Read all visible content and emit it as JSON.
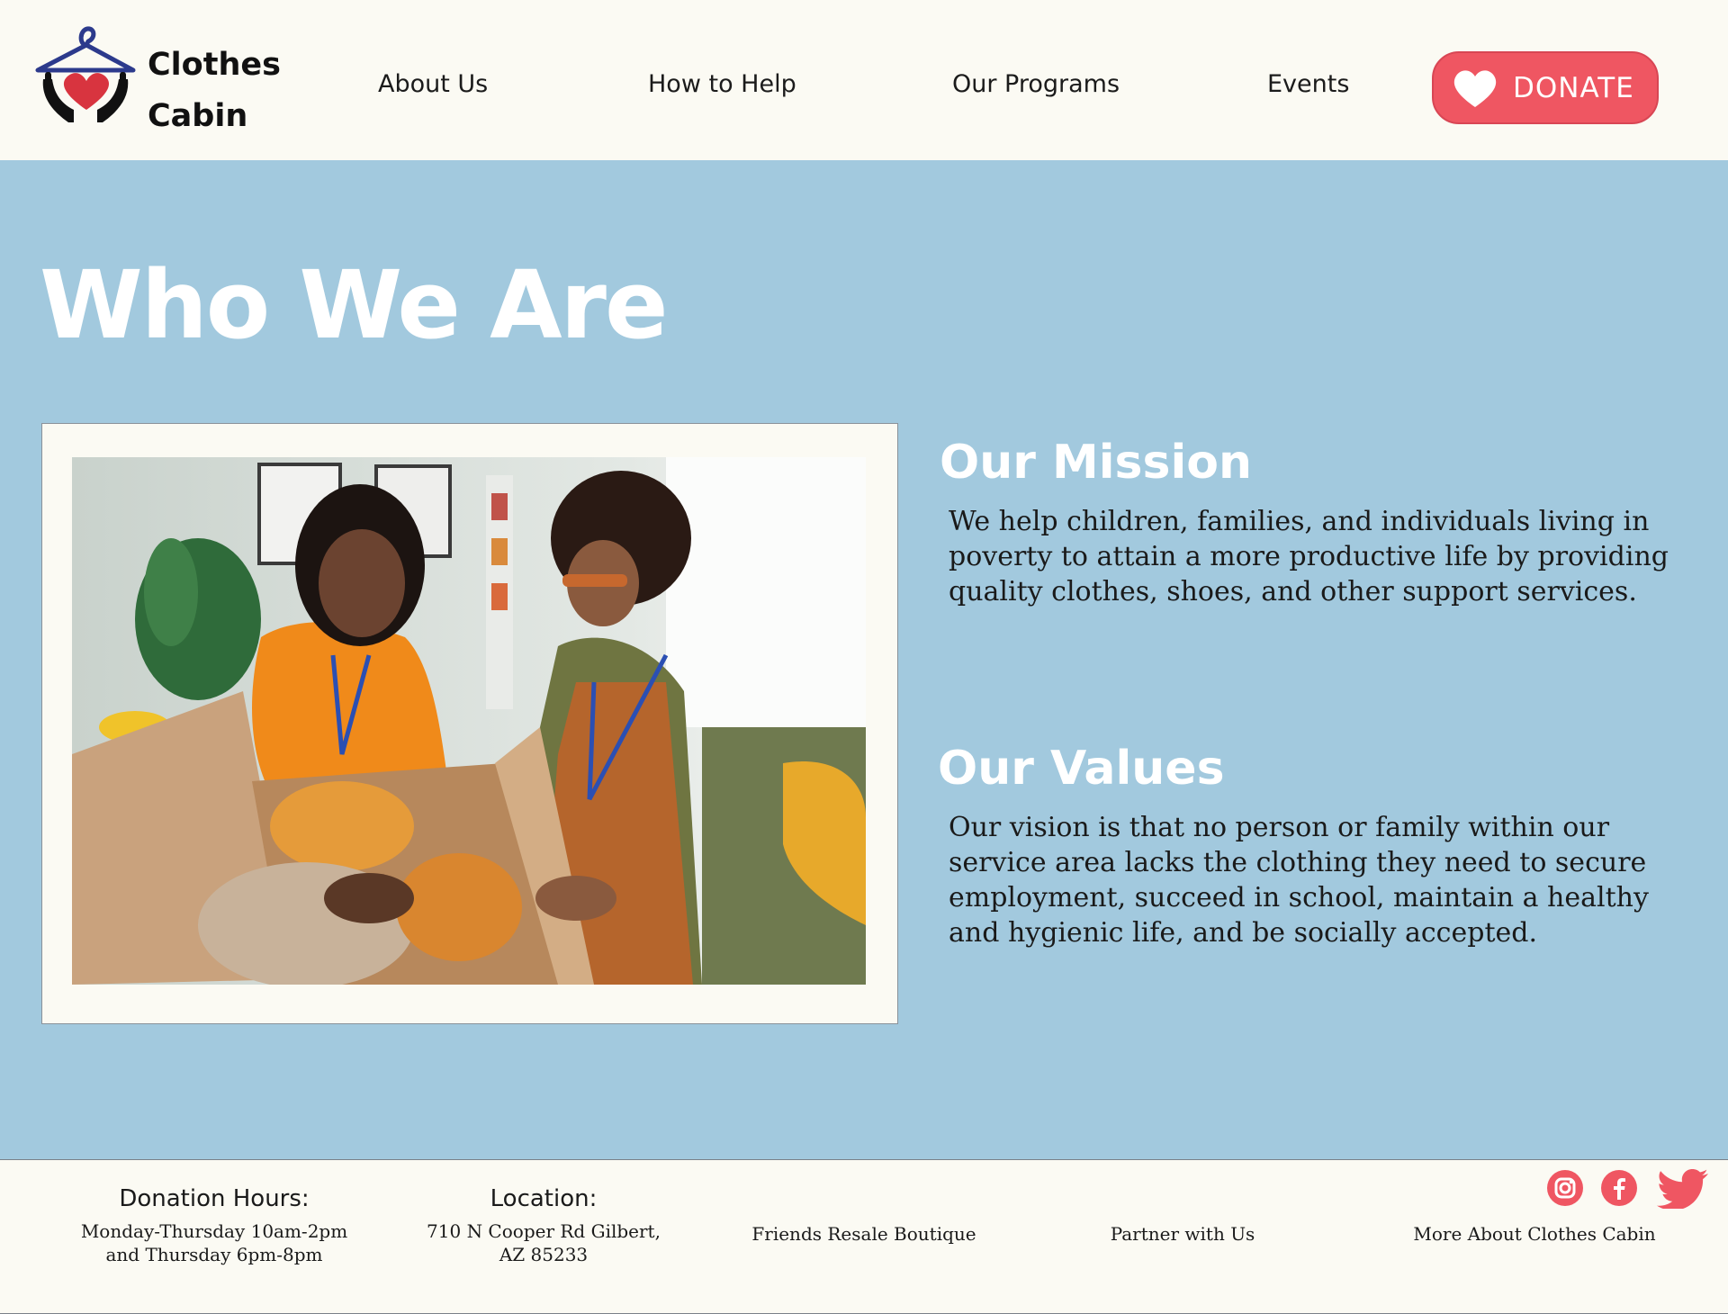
{
  "header": {
    "brand_line1": "Clothes",
    "brand_line2": "Cabin",
    "nav": [
      "About Us",
      "How to Help",
      "Our Programs",
      "Events"
    ],
    "donate_label": "DONATE"
  },
  "main": {
    "title": "Who We Are",
    "mission_heading": "Our Mission",
    "mission_text": "We help children, families, and individuals living in poverty to attain a more productive life by providing quality clothes, shoes, and other support services.",
    "values_heading": "Our Values",
    "values_text": "Our vision is that no person or family within our service area lacks the clothing they need to secure employment, succeed in school, maintain a healthy and hygienic life, and be socially accepted."
  },
  "footer": {
    "hours_heading": "Donation Hours:",
    "hours_line1": "Monday-Thursday 10am-2pm",
    "hours_line2": "and Thursday 6pm-8pm",
    "location_heading": "Location:",
    "location_line1": "710 N Cooper Rd Gilbert,",
    "location_line2": "AZ 85233",
    "links": [
      "Friends Resale Boutique",
      "Partner with Us",
      "More About Clothes Cabin"
    ],
    "social_icons": [
      "instagram-icon",
      "facebook-icon",
      "twitter-icon"
    ]
  },
  "colors": {
    "accent": "#ef5662",
    "background": "#a2c9de",
    "surface": "#fbfaf3",
    "hanger": "#2c3a8c"
  }
}
